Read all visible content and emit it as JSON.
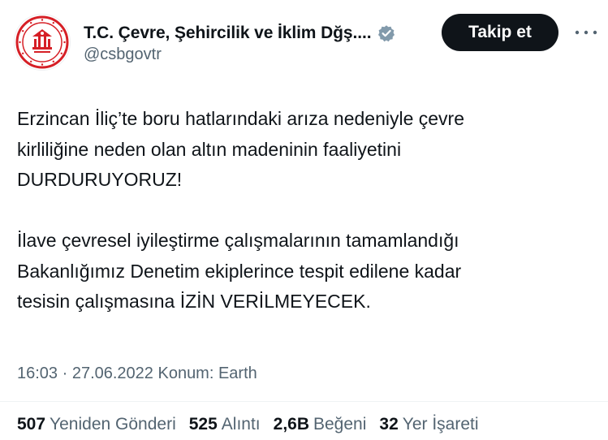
{
  "author": {
    "display_name": "T.C. Çevre, Şehircilik ve İklim Dğş....",
    "handle": "@csbgovtr",
    "avatar_icon": "ministry-emblem-icon",
    "verified_icon": "verified-badge-icon",
    "verified_color": "#829aab"
  },
  "follow_button": {
    "label": "Takip et"
  },
  "tweet": {
    "paragraphs": [
      {
        "lines": [
          "Erzincan İliç’te boru hatlarındaki arıza nedeniyle çevre",
          "kirliliğine neden olan altın madeninin faaliyetini",
          "DURDURUYORUZ!"
        ]
      },
      {
        "lines": [
          "İlave çevresel iyileştirme çalışmalarının tamamlandığı",
          "Bakanlığımız Denetim ekiplerince tespit edilene kadar",
          "tesisin çalışmasına İZİN VERİLMEYECEK."
        ]
      }
    ]
  },
  "meta": {
    "text": "16:03 · 27.06.2022 Konum: Earth"
  },
  "stats": [
    {
      "count": "507",
      "label": "Yeniden Gönderi"
    },
    {
      "count": "525",
      "label": "Alıntı"
    },
    {
      "count": "2,6B",
      "label": "Beğeni"
    },
    {
      "count": "32",
      "label": "Yer İşareti"
    }
  ],
  "colors": {
    "text_primary": "#0f1419",
    "text_secondary": "#536471",
    "emblem_red": "#d61f26",
    "button_bg": "#0f1419"
  }
}
